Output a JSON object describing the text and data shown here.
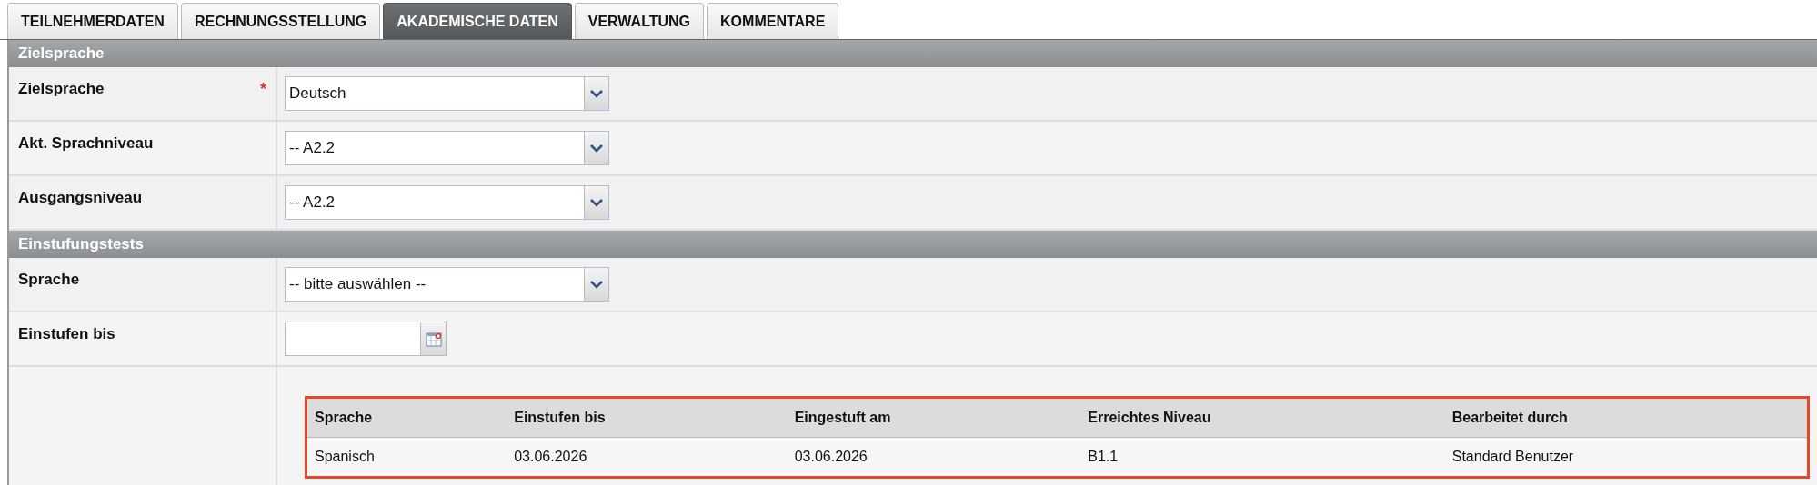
{
  "tabs": [
    {
      "label": "TEILNEHMERDATEN",
      "selected": false
    },
    {
      "label": "RECHNUNGSSTELLUNG",
      "selected": false
    },
    {
      "label": "AKADEMISCHE DATEN",
      "selected": true
    },
    {
      "label": "VERWALTUNG",
      "selected": false
    },
    {
      "label": "KOMMENTARE",
      "selected": false
    }
  ],
  "sections": [
    {
      "title": "Zielsprache",
      "fields": [
        {
          "label": "Zielsprache",
          "required_mark": "*",
          "kind": "select",
          "value": "Deutsch"
        },
        {
          "label": "Akt. Sprachniveau",
          "kind": "select",
          "value": "-- A2.2"
        },
        {
          "label": "Ausgangsniveau",
          "kind": "select",
          "value": "-- A2.2"
        }
      ]
    },
    {
      "title": "Einstufungstests",
      "fields": [
        {
          "label": "Sprache",
          "kind": "select",
          "value": "-- bitte auswählen --"
        },
        {
          "label": "Einstufen bis",
          "kind": "date"
        }
      ],
      "table": {
        "columns": [
          "Sprache",
          "Einstufen bis",
          "Eingestuft am",
          "Erreichtes Niveau",
          "Bearbeitet durch"
        ],
        "rows": [
          [
            "Spanisch",
            "03.06.2026",
            "03.06.2026",
            "B1.1",
            "Standard Benutzer"
          ]
        ]
      }
    }
  ]
}
